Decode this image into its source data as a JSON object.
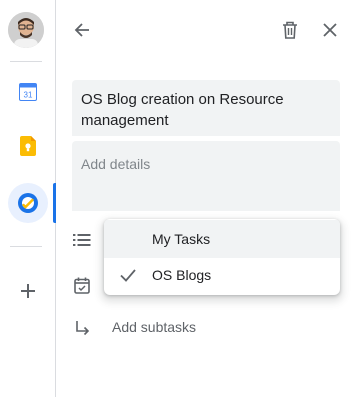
{
  "task": {
    "title": "OS Blog creation on Resource management",
    "details_placeholder": "Add details",
    "add_subtasks_label": "Add subtasks"
  },
  "list_menu": {
    "items": [
      {
        "label": "My Tasks",
        "selected": false
      },
      {
        "label": "OS Blogs",
        "selected": true
      }
    ]
  },
  "rail": {
    "calendar_icon_text": "31"
  },
  "colors": {
    "accent": "#1a73e8",
    "keep_yellow": "#fbbc04",
    "calendar_blue": "#4285f4",
    "field_bg": "#f1f3f4",
    "icon_gray": "#5f6368"
  },
  "icons": [
    "back-arrow-icon",
    "trash-icon",
    "close-icon",
    "list-icon",
    "calendar-date-icon",
    "subtask-arrow-icon",
    "check-icon",
    "plus-icon"
  ]
}
